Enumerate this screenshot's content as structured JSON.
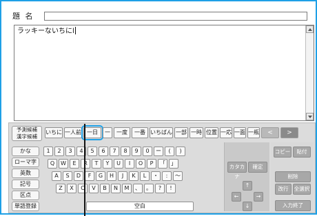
{
  "title_row": {
    "label": "題 名"
  },
  "editor": {
    "text": "ラッキーないちにl"
  },
  "candidates": {
    "mode": {
      "line1": "予測候補",
      "line2": "漢字候補"
    },
    "items": [
      "いちに",
      "一人前",
      "一日",
      "一",
      "一度",
      "一番",
      "いちばん",
      "一部",
      "一時",
      "位置",
      "一応",
      "一面",
      "一瓶",
      "一群"
    ],
    "prev_label": "<",
    "next_label": ">"
  },
  "sidebar": {
    "items": [
      "かな",
      "ローマ字",
      "英数",
      "記号",
      "区点",
      "単語登録"
    ]
  },
  "keyboard": {
    "row1": [
      "1",
      "2",
      "3",
      "4",
      "5",
      "6",
      "7",
      "8",
      "9",
      "0",
      "ー",
      "(",
      ")"
    ],
    "row2": [
      "Q",
      "W",
      "E",
      "R",
      "T",
      "Y",
      "U",
      "I",
      "O",
      "P",
      "「",
      "」"
    ],
    "row3": [
      "A",
      "S",
      "D",
      "F",
      "G",
      "H",
      "J",
      "K",
      "L",
      "・",
      ":",
      "～"
    ],
    "row4": [
      "Z",
      "X",
      "C",
      "V",
      "B",
      "N",
      "M",
      "、",
      "。",
      "?",
      "!"
    ],
    "space_label": "空白"
  },
  "actions": {
    "katakana": "カタカナ",
    "confirm": "確定",
    "copy": "コピー",
    "paste": "貼付",
    "delete": "削除",
    "newline": "改行",
    "select_all": "全選択",
    "finish": "入力終了"
  },
  "arrows": {
    "up": "↑",
    "left": "←",
    "right": "→",
    "down": "↓"
  }
}
